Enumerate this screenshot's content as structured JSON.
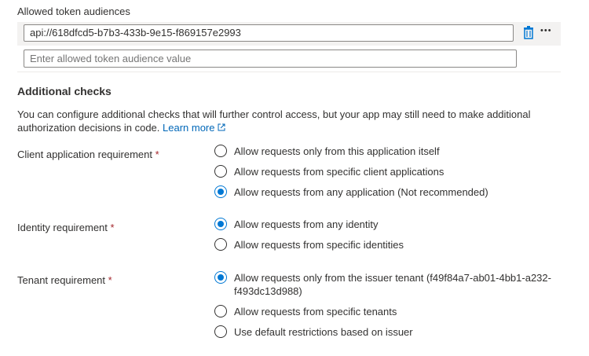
{
  "token_audiences": {
    "label": "Allowed token audiences",
    "value": "api://618dfcd5-b7b3-433b-9e15-f869157e2993",
    "placeholder": "Enter allowed token audience value",
    "delete_icon": "trash-icon",
    "more_icon": "ellipsis-icon",
    "more_text": "•••"
  },
  "additional_checks": {
    "title": "Additional checks",
    "description": "You can configure additional checks that will further control access, but your app may still need to make additional authorization decisions in code.",
    "learn_more": "Learn more",
    "external_icon": "external-link-icon"
  },
  "client_requirement": {
    "label": "Client application requirement",
    "required": "*",
    "options": [
      {
        "label": "Allow requests only from this application itself",
        "selected": false
      },
      {
        "label": "Allow requests from specific client applications",
        "selected": false
      },
      {
        "label": "Allow requests from any application (Not recommended)",
        "selected": true
      }
    ]
  },
  "identity_requirement": {
    "label": "Identity requirement",
    "required": "*",
    "options": [
      {
        "label": "Allow requests from any identity",
        "selected": true
      },
      {
        "label": "Allow requests from specific identities",
        "selected": false
      }
    ]
  },
  "tenant_requirement": {
    "label": "Tenant requirement",
    "required": "*",
    "options": [
      {
        "label": "Allow requests only from the issuer tenant (f49f84a7-ab01-4bb1-a232-f493dc13d988)",
        "selected": true
      },
      {
        "label": "Allow requests from specific tenants",
        "selected": false
      },
      {
        "label": "Use default restrictions based on issuer",
        "selected": false
      }
    ]
  },
  "colors": {
    "accent": "#0078d4",
    "link": "#0067b8",
    "required": "#a4262c"
  }
}
